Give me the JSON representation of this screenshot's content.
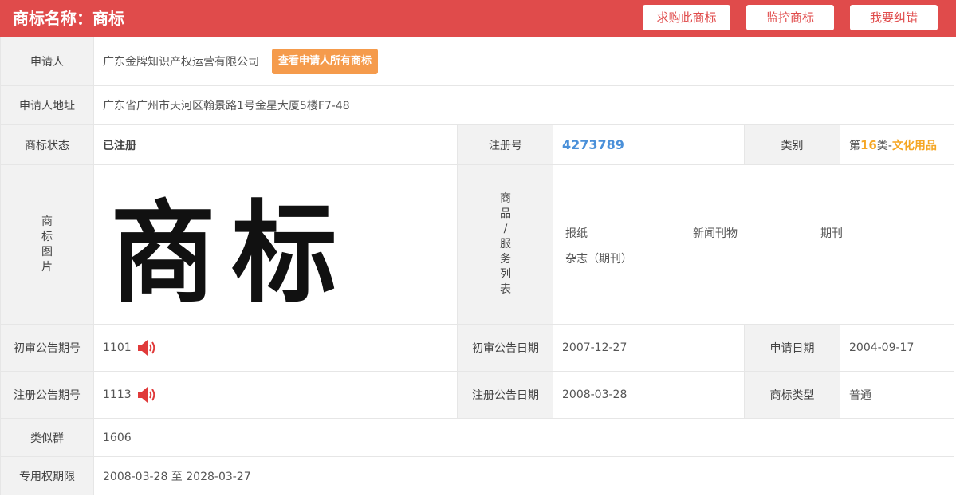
{
  "header": {
    "title": "商标名称：商标",
    "buy_label": "求购此商标",
    "monitor_label": "监控商标",
    "report_label": "我要纠错",
    "bg_color": "#e04b4b"
  },
  "applicant": {
    "label": "申请人",
    "value": "广东金牌知识产权运营有限公司",
    "view_all_label": "查看申请人所有商标"
  },
  "address": {
    "label": "申请人地址",
    "value": "广东省广州市天河区翰景路1号金星大厦5楼F7-48"
  },
  "status": {
    "label": "商标状态",
    "value": "已注册",
    "reg_no_label": "注册号",
    "reg_no": "4273789",
    "category_label": "类别",
    "category_prefix": "第",
    "category_num": "16",
    "category_mid": "类-",
    "category_name": "文化用品"
  },
  "image_row": {
    "label_chars": [
      "商",
      "标",
      "图",
      "片"
    ],
    "mark_text": "商标",
    "goods_label_chars": [
      "商",
      "品",
      "/",
      "服",
      "务",
      "列",
      "表"
    ],
    "goods": [
      "报纸",
      "新闻刊物",
      "期刊",
      "杂志（期刊）"
    ]
  },
  "prelim": {
    "label": "初审公告期号",
    "value": "1101",
    "date_label": "初审公告日期",
    "date": "2007-12-27",
    "apply_label": "申请日期",
    "apply_date": "2004-09-17"
  },
  "reg_pub": {
    "label": "注册公告期号",
    "value": "1113",
    "date_label": "注册公告日期",
    "date": "2008-03-28",
    "type_label": "商标类型",
    "type": "普通"
  },
  "similar": {
    "label": "类似群",
    "value": "1606"
  },
  "term": {
    "label": "专用权期限",
    "value": "2008-03-28 至 2028-03-27"
  }
}
